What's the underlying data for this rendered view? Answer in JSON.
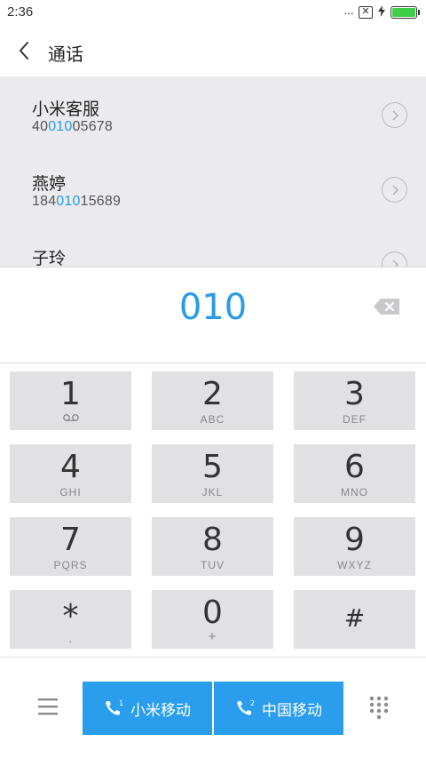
{
  "status_bar": {
    "time": "2:36",
    "signal": "···",
    "battery_level": 1.0,
    "battery_color": "#3ecf4a"
  },
  "header": {
    "title": "通话"
  },
  "results": [
    {
      "name": "小米客服",
      "number_pre": "40",
      "number_match": "010",
      "number_post": "05678"
    },
    {
      "name": "燕婷",
      "number_pre": "184",
      "number_match": "010",
      "number_post": "15689"
    },
    {
      "name": "子玲",
      "number_pre": "",
      "number_match": "",
      "number_post": ""
    }
  ],
  "dialed_number": "010",
  "keypad": {
    "keys": [
      {
        "digit": "1",
        "letters": ""
      },
      {
        "digit": "2",
        "letters": "ABC"
      },
      {
        "digit": "3",
        "letters": "DEF"
      },
      {
        "digit": "4",
        "letters": "GHI"
      },
      {
        "digit": "5",
        "letters": "JKL"
      },
      {
        "digit": "6",
        "letters": "MNO"
      },
      {
        "digit": "7",
        "letters": "PQRS"
      },
      {
        "digit": "8",
        "letters": "TUV"
      },
      {
        "digit": "9",
        "letters": "WXYZ"
      },
      {
        "digit": "*",
        "letters": ","
      },
      {
        "digit": "0",
        "letters": "+"
      },
      {
        "digit": "#",
        "letters": ""
      }
    ]
  },
  "bottom_bar": {
    "sim1_label": "小米移动",
    "sim2_label": "中国移动",
    "sim1_badge": "1",
    "sim2_badge": "2"
  },
  "colors": {
    "accent": "#2a9be8",
    "call_button": "#2a9ded"
  }
}
